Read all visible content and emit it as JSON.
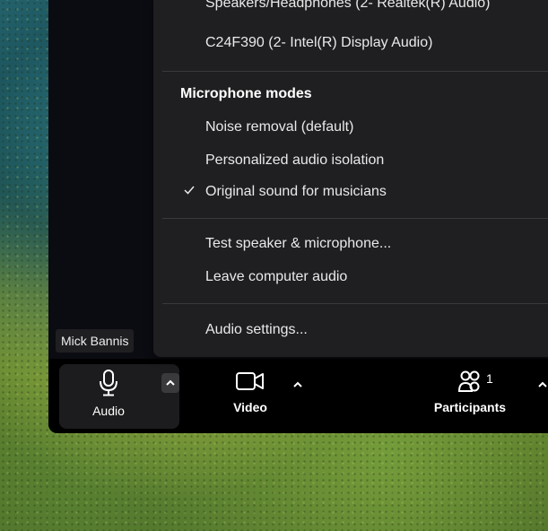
{
  "menu": {
    "speakers_partial": "Speakers/Headphones (2- Realtek(R) Audio)",
    "display_audio": "C24F390 (2- Intel(R) Display Audio)",
    "mic_modes_header": "Microphone modes",
    "noise_removal": "Noise removal (default)",
    "personalized_isolation": "Personalized audio isolation",
    "original_sound": "Original sound for musicians",
    "selected_mode": "Original sound for musicians",
    "test_speaker_mic": "Test speaker & microphone...",
    "leave_audio": "Leave computer audio",
    "audio_settings": "Audio settings..."
  },
  "participant": {
    "name_label": "Mick Bannis"
  },
  "toolbar": {
    "audio_label": "Audio",
    "video_label": "Video",
    "participants_label": "Participants",
    "participants_count": "1"
  },
  "icons": {
    "microphone": "microphone-icon",
    "video": "video-camera-icon",
    "participants": "participants-icon",
    "caret": "chevron-up-icon",
    "check": "checkmark-icon"
  },
  "colors": {
    "menu_bg": "#1f1f21",
    "toolbar_bg": "#000000",
    "text": "#e9e9ea",
    "active_button_bg": "#1c1c1e"
  }
}
